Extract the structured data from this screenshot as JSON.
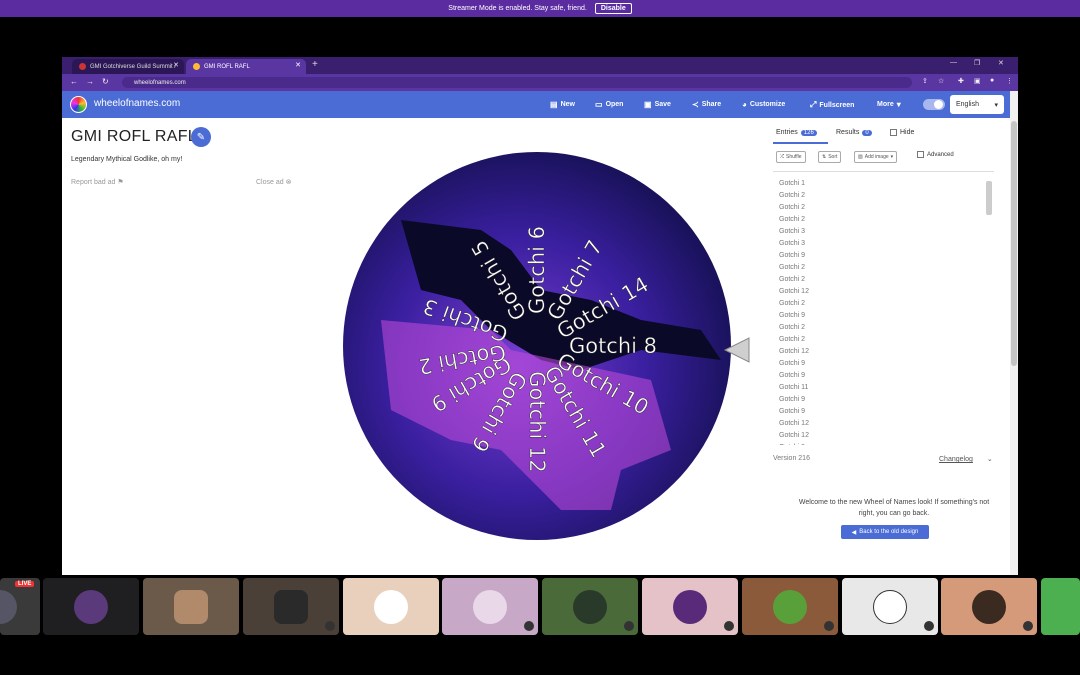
{
  "banner": {
    "text": "Streamer Mode is enabled. Stay safe, friend.",
    "button": "Disable"
  },
  "browser": {
    "tabs": [
      {
        "title": "GMI Gotchiverse Guild Summit /"
      },
      {
        "title": "GMI ROFL RAFL"
      }
    ],
    "new_tab": "+",
    "url": "wheelofnames.com"
  },
  "app": {
    "site_name": "wheelofnames.com",
    "nav": [
      {
        "label": "New",
        "icon": "file-icon"
      },
      {
        "label": "Open",
        "icon": "folder-icon"
      },
      {
        "label": "Save",
        "icon": "save-icon"
      },
      {
        "label": "Share",
        "icon": "share-icon"
      },
      {
        "label": "Customize",
        "icon": "palette-icon"
      },
      {
        "label": "Fullscreen",
        "icon": "fullscreen-icon"
      },
      {
        "label": "More",
        "icon": "chevron-down-icon"
      }
    ],
    "language": "English"
  },
  "wheel_panel": {
    "title": "GMI ROFL RAFL",
    "description": "Legendary Mythical Godlike, oh my!",
    "report": "Report bad ad",
    "close": "Close ad",
    "wheel_labels": [
      "Gotchi 8",
      "Gotchi 10",
      "Gotchi 11",
      "Gotchi 12",
      "Gotchi 9",
      "Gotchi 9",
      "Gotchi 2",
      "Gotchi 3",
      "Gotchi 5",
      "Gotchi 6",
      "Gotchi 7",
      "Gotchi 14"
    ]
  },
  "side_panel": {
    "entries_tab": "Entries",
    "entries_count": "126",
    "results_tab": "Results",
    "results_count": "0",
    "hide_label": "Hide",
    "tools": {
      "shuffle": "Shuffle",
      "sort": "Sort",
      "add_image": "Add image",
      "advanced": "Advanced"
    },
    "entries": [
      "Gotchi 1",
      "Gotchi 2",
      "Gotchi 2",
      "Gotchi 2",
      "Gotchi 3",
      "Gotchi 3",
      "Gotchi 9",
      "Gotchi 2",
      "Gotchi 2",
      "Gotchi 12",
      "Gotchi 2",
      "Gotchi 9",
      "Gotchi 2",
      "Gotchi 2",
      "Gotchi 12",
      "Gotchi 9",
      "Gotchi 9",
      "Gotchi 11",
      "Gotchi 9",
      "Gotchi 9",
      "Gotchi 12",
      "Gotchi 12",
      "Gotchi 9"
    ],
    "version": "Version 216",
    "changelog": "Changelog",
    "welcome_text": "Welcome to the new Wheel of Names look! If something's not right, you can go back.",
    "old_design_button": "Back to the old design"
  },
  "participants": [
    {
      "name": "live-stream",
      "live": "LIVE"
    },
    {
      "name": "cat-crown"
    },
    {
      "name": "webcam-1"
    },
    {
      "name": "webcam-2"
    },
    {
      "name": "red-cap"
    },
    {
      "name": "ghost-purple"
    },
    {
      "name": "dark-figure"
    },
    {
      "name": "skull-mask"
    },
    {
      "name": "green-frog"
    },
    {
      "name": "eye-chart"
    },
    {
      "name": "bearded-man"
    }
  ],
  "colors": {
    "accent": "#4a6cd4",
    "banner": "#5b2ca0",
    "browser": "#5a36a3"
  }
}
